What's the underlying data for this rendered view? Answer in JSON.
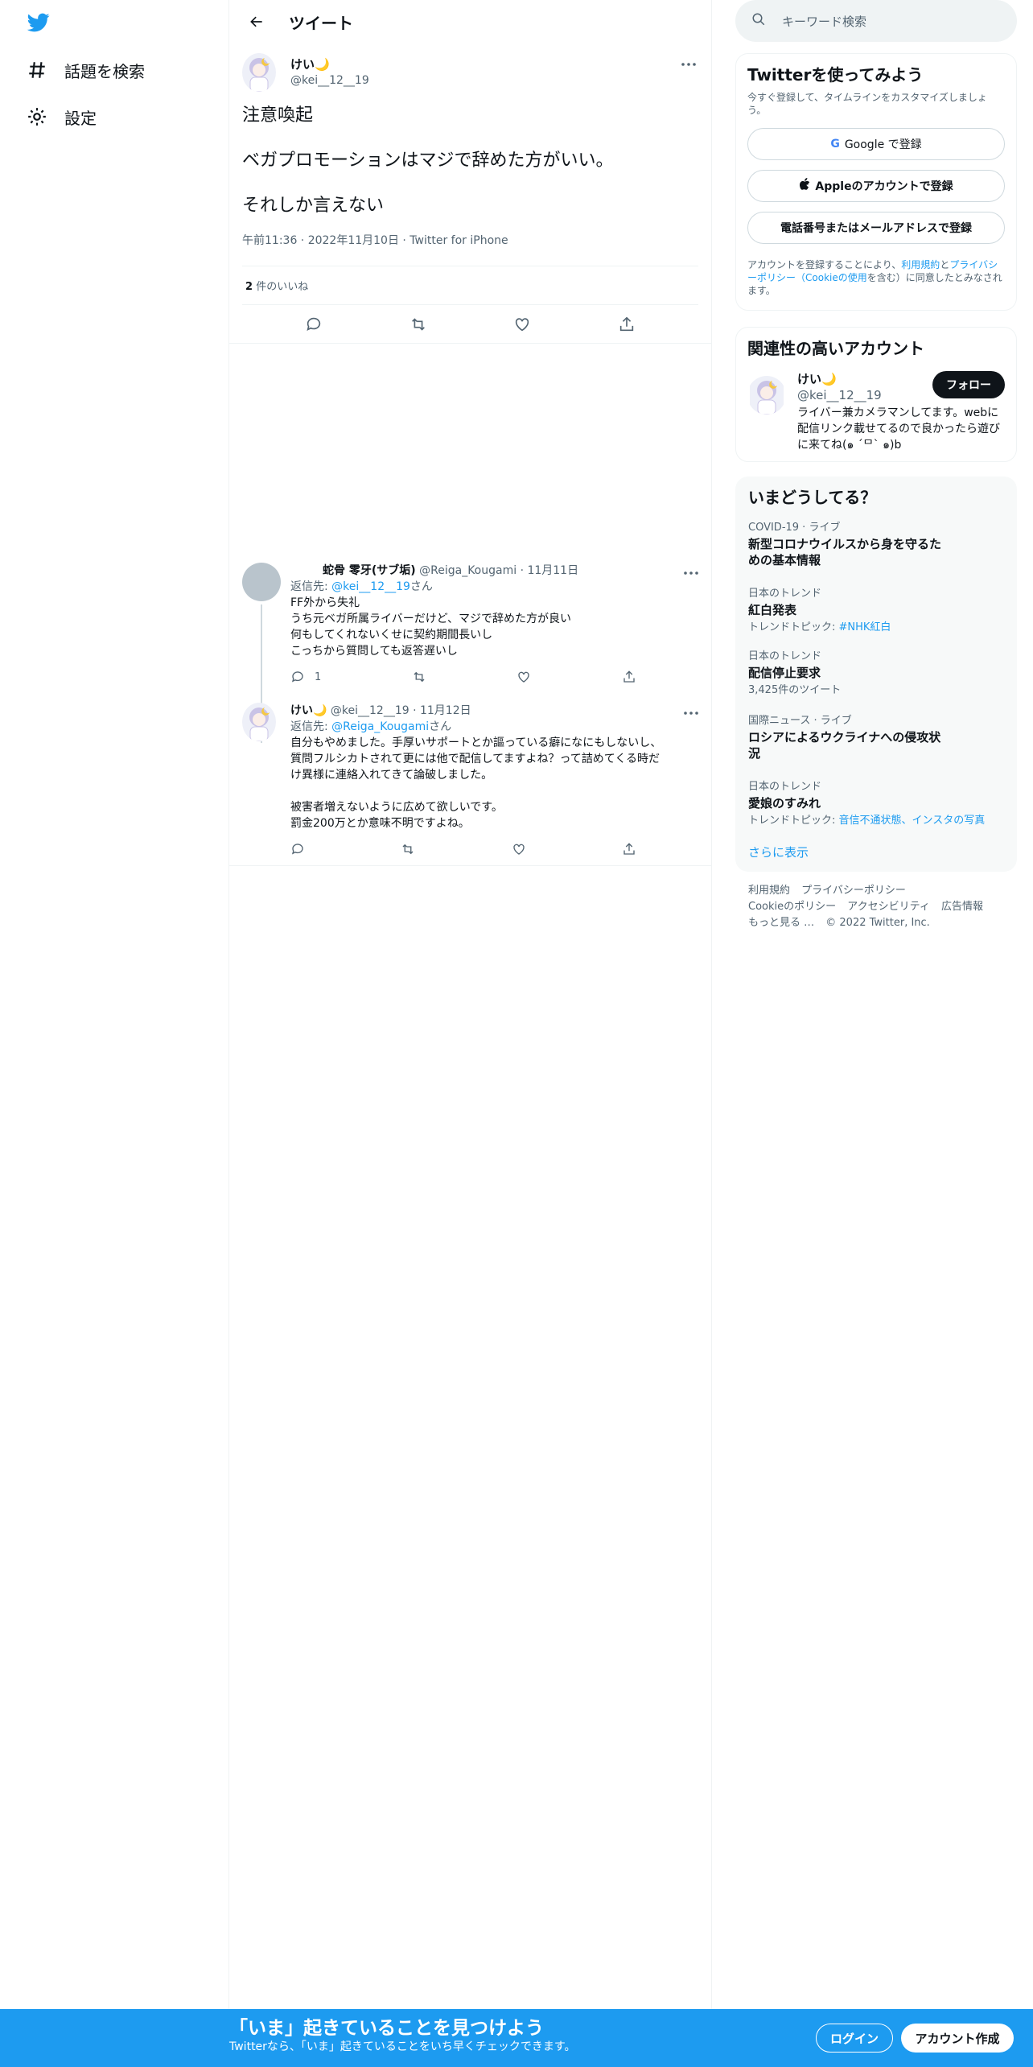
{
  "nav": {
    "items": [
      {
        "label": "話題を検索",
        "icon": "hashtag-icon"
      },
      {
        "label": "設定",
        "icon": "gear-icon"
      }
    ]
  },
  "header": {
    "title": "ツイート"
  },
  "focal_tweet": {
    "author_name": "けい🌙",
    "author_handle": "@kei__12__19",
    "paragraphs": [
      "注意喚起",
      "ベガプロモーションはマジで辞めた方がいい。",
      "それしか言えない"
    ],
    "meta": "午前11:36 · 2022年11月10日 · Twitter for iPhone",
    "likes_count": "2",
    "likes_label": "件のいいね"
  },
  "replies": [
    {
      "author_name": "蛇骨 零牙(サブ垢)",
      "author_handle": "@Reiga_Kougami",
      "date": "· 11月11日",
      "reply_to_prefix": "返信先: ",
      "reply_to_handle": "@kei__12__19",
      "reply_to_suffix": "さん",
      "lines": [
        "FF外から失礼",
        "うち元ベガ所属ライバーだけど、マジで辞めた方が良い",
        "何もしてくれないくせに契約期間長いし",
        "こっちから質問しても返答遅いし"
      ],
      "reply_count": "1"
    },
    {
      "author_name": "けい🌙",
      "author_handle": "@kei__12__19",
      "date": "· 11月12日",
      "reply_to_prefix": "返信先: ",
      "reply_to_handle": "@Reiga_Kougami",
      "reply_to_suffix": "さん",
      "lines": [
        "自分もやめました。手厚いサポートとか謳っている癖になにもしないし、",
        "質問フルシカトされて更には他で配信してますよね？って詰めてくる時だ",
        "け異様に連絡入れてきて論破しました。",
        "",
        "被害者増えないように広めて欲しいです。",
        "罰金200万とか意味不明ですよね。"
      ],
      "reply_count": ""
    }
  ],
  "search": {
    "placeholder": "キーワード検索"
  },
  "signup_card": {
    "title": "Twitterを使ってみよう",
    "subtitle": "今すぐ登録して、タイムラインをカスタマイズしましょう。",
    "google_g": "G",
    "google_label": "Google で登録",
    "apple_label": "Appleのアカウントで登録",
    "phone_label": "電話番号またはメールアドレスで登録",
    "legal_1": "アカウントを登録することにより、",
    "legal_link_1": "利用規約",
    "legal_2": "と",
    "legal_link_2": "プライバシーポリシー（Cookieの使用",
    "legal_3": "を含む）に同意したとみなされます。"
  },
  "relevant": {
    "title": "関連性の高いアカウント",
    "name": "けい🌙",
    "handle": "@kei__12__19",
    "bio": "ライバー兼カメラマンしてます。webに配信リンク載せてるので良かったら遊びに来てね(๑ ´ᄆ` ๑)b",
    "follow_label": "フォロー"
  },
  "trends": {
    "title": "いまどうしてる？",
    "items": [
      {
        "context": "COVID-19 · ライブ",
        "name": "新型コロナウイルスから身を守るための基本情報",
        "extra_prefix": "",
        "extra_link": ""
      },
      {
        "context": "日本のトレンド",
        "name": "紅白発表",
        "extra_prefix": "トレンドトピック: ",
        "extra_link": "#NHK紅白"
      },
      {
        "context": "日本のトレンド",
        "name": "配信停止要求",
        "extra_prefix": "3,425件のツイート",
        "extra_link": ""
      },
      {
        "context": "国際ニュース · ライブ",
        "name": "ロシアによるウクライナへの侵攻状況",
        "extra_prefix": "",
        "extra_link": ""
      },
      {
        "context": "日本のトレンド",
        "name": "愛娘のすみれ",
        "extra_prefix": "トレンドトピック: ",
        "extra_link": "音信不通状態、インスタの写真"
      }
    ],
    "show_more": "さらに表示"
  },
  "footer": {
    "links": [
      "利用規約",
      "プライバシーポリシー",
      "Cookieのポリシー",
      "アクセシビリティ",
      "広告情報",
      "もっと見る …",
      "© 2022 Twitter, Inc."
    ]
  },
  "bottom_bar": {
    "title": "「いま」起きていることを見つけよう",
    "subtitle": "Twitterなら、「いま」起きていることをいち早くチェックできます。",
    "login_label": "ログイン",
    "signup_label": "アカウント作成"
  },
  "colors": {
    "accent": "#1d9bf0",
    "text": "#0f1419",
    "muted": "#536471",
    "border": "#eff3f4"
  }
}
